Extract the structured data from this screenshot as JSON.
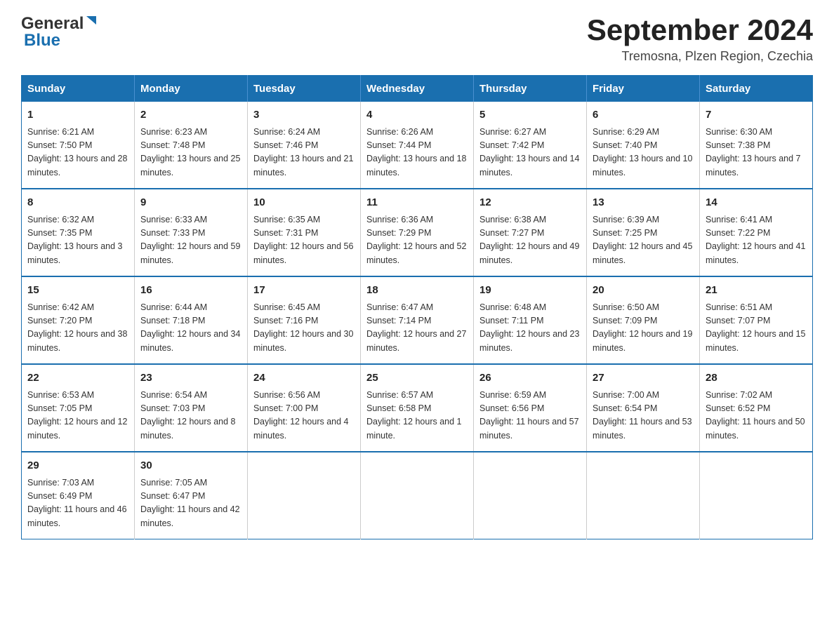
{
  "header": {
    "logo_general": "General",
    "logo_blue": "Blue",
    "month_year": "September 2024",
    "location": "Tremosna, Plzen Region, Czechia"
  },
  "calendar": {
    "days_of_week": [
      "Sunday",
      "Monday",
      "Tuesday",
      "Wednesday",
      "Thursday",
      "Friday",
      "Saturday"
    ],
    "weeks": [
      [
        {
          "day": "1",
          "sunrise": "Sunrise: 6:21 AM",
          "sunset": "Sunset: 7:50 PM",
          "daylight": "Daylight: 13 hours and 28 minutes."
        },
        {
          "day": "2",
          "sunrise": "Sunrise: 6:23 AM",
          "sunset": "Sunset: 7:48 PM",
          "daylight": "Daylight: 13 hours and 25 minutes."
        },
        {
          "day": "3",
          "sunrise": "Sunrise: 6:24 AM",
          "sunset": "Sunset: 7:46 PM",
          "daylight": "Daylight: 13 hours and 21 minutes."
        },
        {
          "day": "4",
          "sunrise": "Sunrise: 6:26 AM",
          "sunset": "Sunset: 7:44 PM",
          "daylight": "Daylight: 13 hours and 18 minutes."
        },
        {
          "day": "5",
          "sunrise": "Sunrise: 6:27 AM",
          "sunset": "Sunset: 7:42 PM",
          "daylight": "Daylight: 13 hours and 14 minutes."
        },
        {
          "day": "6",
          "sunrise": "Sunrise: 6:29 AM",
          "sunset": "Sunset: 7:40 PM",
          "daylight": "Daylight: 13 hours and 10 minutes."
        },
        {
          "day": "7",
          "sunrise": "Sunrise: 6:30 AM",
          "sunset": "Sunset: 7:38 PM",
          "daylight": "Daylight: 13 hours and 7 minutes."
        }
      ],
      [
        {
          "day": "8",
          "sunrise": "Sunrise: 6:32 AM",
          "sunset": "Sunset: 7:35 PM",
          "daylight": "Daylight: 13 hours and 3 minutes."
        },
        {
          "day": "9",
          "sunrise": "Sunrise: 6:33 AM",
          "sunset": "Sunset: 7:33 PM",
          "daylight": "Daylight: 12 hours and 59 minutes."
        },
        {
          "day": "10",
          "sunrise": "Sunrise: 6:35 AM",
          "sunset": "Sunset: 7:31 PM",
          "daylight": "Daylight: 12 hours and 56 minutes."
        },
        {
          "day": "11",
          "sunrise": "Sunrise: 6:36 AM",
          "sunset": "Sunset: 7:29 PM",
          "daylight": "Daylight: 12 hours and 52 minutes."
        },
        {
          "day": "12",
          "sunrise": "Sunrise: 6:38 AM",
          "sunset": "Sunset: 7:27 PM",
          "daylight": "Daylight: 12 hours and 49 minutes."
        },
        {
          "day": "13",
          "sunrise": "Sunrise: 6:39 AM",
          "sunset": "Sunset: 7:25 PM",
          "daylight": "Daylight: 12 hours and 45 minutes."
        },
        {
          "day": "14",
          "sunrise": "Sunrise: 6:41 AM",
          "sunset": "Sunset: 7:22 PM",
          "daylight": "Daylight: 12 hours and 41 minutes."
        }
      ],
      [
        {
          "day": "15",
          "sunrise": "Sunrise: 6:42 AM",
          "sunset": "Sunset: 7:20 PM",
          "daylight": "Daylight: 12 hours and 38 minutes."
        },
        {
          "day": "16",
          "sunrise": "Sunrise: 6:44 AM",
          "sunset": "Sunset: 7:18 PM",
          "daylight": "Daylight: 12 hours and 34 minutes."
        },
        {
          "day": "17",
          "sunrise": "Sunrise: 6:45 AM",
          "sunset": "Sunset: 7:16 PM",
          "daylight": "Daylight: 12 hours and 30 minutes."
        },
        {
          "day": "18",
          "sunrise": "Sunrise: 6:47 AM",
          "sunset": "Sunset: 7:14 PM",
          "daylight": "Daylight: 12 hours and 27 minutes."
        },
        {
          "day": "19",
          "sunrise": "Sunrise: 6:48 AM",
          "sunset": "Sunset: 7:11 PM",
          "daylight": "Daylight: 12 hours and 23 minutes."
        },
        {
          "day": "20",
          "sunrise": "Sunrise: 6:50 AM",
          "sunset": "Sunset: 7:09 PM",
          "daylight": "Daylight: 12 hours and 19 minutes."
        },
        {
          "day": "21",
          "sunrise": "Sunrise: 6:51 AM",
          "sunset": "Sunset: 7:07 PM",
          "daylight": "Daylight: 12 hours and 15 minutes."
        }
      ],
      [
        {
          "day": "22",
          "sunrise": "Sunrise: 6:53 AM",
          "sunset": "Sunset: 7:05 PM",
          "daylight": "Daylight: 12 hours and 12 minutes."
        },
        {
          "day": "23",
          "sunrise": "Sunrise: 6:54 AM",
          "sunset": "Sunset: 7:03 PM",
          "daylight": "Daylight: 12 hours and 8 minutes."
        },
        {
          "day": "24",
          "sunrise": "Sunrise: 6:56 AM",
          "sunset": "Sunset: 7:00 PM",
          "daylight": "Daylight: 12 hours and 4 minutes."
        },
        {
          "day": "25",
          "sunrise": "Sunrise: 6:57 AM",
          "sunset": "Sunset: 6:58 PM",
          "daylight": "Daylight: 12 hours and 1 minute."
        },
        {
          "day": "26",
          "sunrise": "Sunrise: 6:59 AM",
          "sunset": "Sunset: 6:56 PM",
          "daylight": "Daylight: 11 hours and 57 minutes."
        },
        {
          "day": "27",
          "sunrise": "Sunrise: 7:00 AM",
          "sunset": "Sunset: 6:54 PM",
          "daylight": "Daylight: 11 hours and 53 minutes."
        },
        {
          "day": "28",
          "sunrise": "Sunrise: 7:02 AM",
          "sunset": "Sunset: 6:52 PM",
          "daylight": "Daylight: 11 hours and 50 minutes."
        }
      ],
      [
        {
          "day": "29",
          "sunrise": "Sunrise: 7:03 AM",
          "sunset": "Sunset: 6:49 PM",
          "daylight": "Daylight: 11 hours and 46 minutes."
        },
        {
          "day": "30",
          "sunrise": "Sunrise: 7:05 AM",
          "sunset": "Sunset: 6:47 PM",
          "daylight": "Daylight: 11 hours and 42 minutes."
        },
        null,
        null,
        null,
        null,
        null
      ]
    ]
  }
}
